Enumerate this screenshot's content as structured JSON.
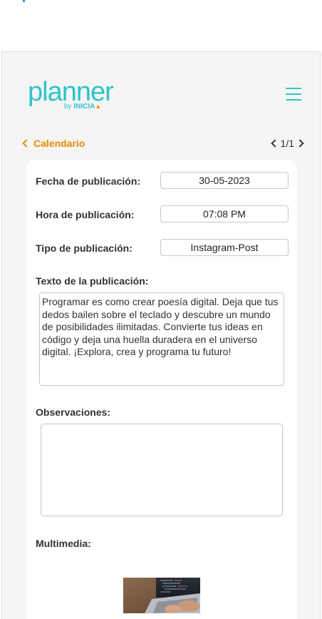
{
  "logo": {
    "main": "planner",
    "by": "by ",
    "brand": "INICIA",
    "mark": "▲"
  },
  "nav": {
    "back_label": "Calendario",
    "pager": "1/1"
  },
  "form": {
    "fecha_label": "Fecha de publicación:",
    "fecha_value": "30-05-2023",
    "hora_label": "Hora de publicación:",
    "hora_value": "07:08 PM",
    "tipo_label": "Tipo de publicación:",
    "tipo_value": "Instagram-Post",
    "texto_label": "Texto de la publicación:",
    "texto_value": "Programar es como crear poesía digital. Deja que tus dedos bailen sobre el teclado y descubre un mundo de posibilidades ilimitadas. Convierte tus ideas en código y deja una huella duradera en el universo digital. ¡Explora, crea y programa tu futuro!",
    "observaciones_label": "Observaciones:",
    "observaciones_value": "",
    "multimedia_label": "Multimedia:"
  },
  "colors": {
    "brand_teal": "#2ec4c8",
    "accent_orange": "#e68a00"
  }
}
